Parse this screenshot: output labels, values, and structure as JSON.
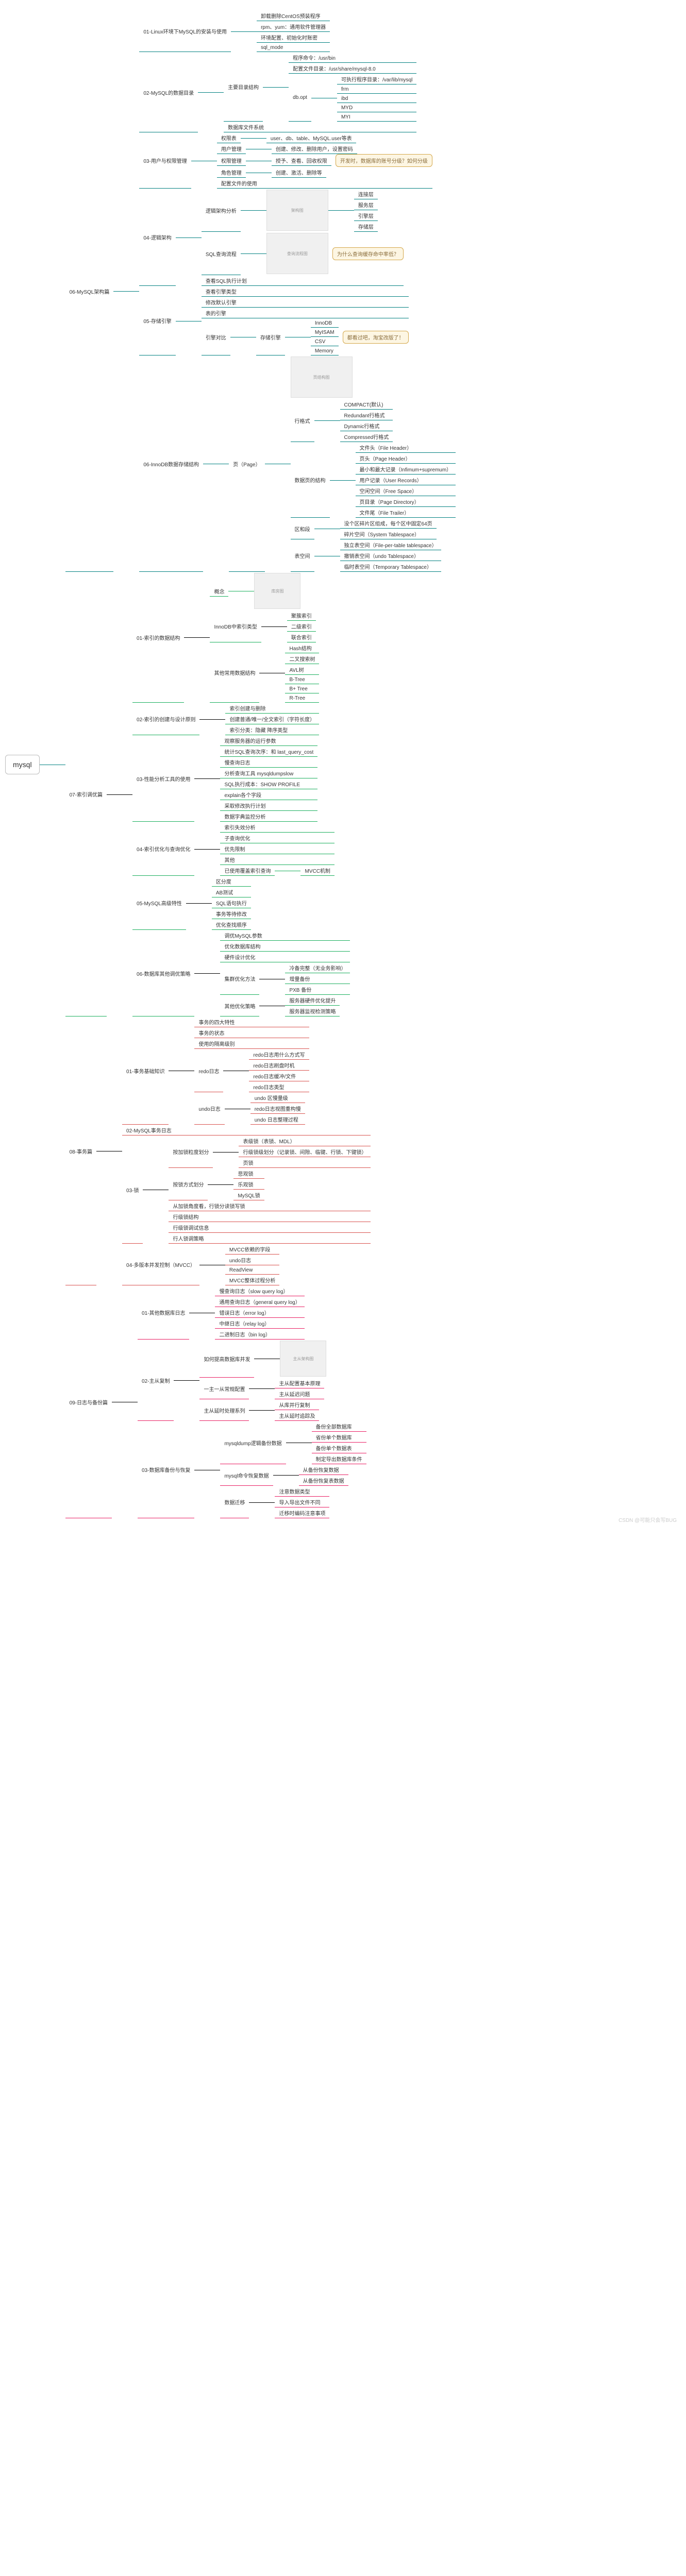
{
  "root": "mysql",
  "watermark": "CSDN @可能只会写BUG",
  "sections": {
    "s06": {
      "title": "06-MySQL架构篇",
      "n01": {
        "title": "01-Linux环境下MySQL的安装与使用",
        "items": [
          "卸载删除CentOS预装程序",
          "rpm、yum：通用软件管理器",
          "环境配置、初始化时账密",
          "sql_mode"
        ]
      },
      "n02": {
        "title": "02-MySQL的数据目录",
        "dir": {
          "label": "主要目录结构",
          "items": [
            {
              "l": "程序命令：/usr/bin"
            },
            {
              "l": "配置文件目录：/usr/share/mysql-8.0"
            },
            {
              "l": "db.opt",
              "sub": [
                "可执行程序目录：/var/lib/mysql",
                "frm",
                "ibd",
                "MYD",
                "MYI"
              ]
            }
          ]
        },
        "file": {
          "label": "数据库文件系统"
        }
      },
      "n03": {
        "title": "03-用户与权限管理",
        "items": [
          {
            "l": "权限表",
            "r": "user、db、table、MySQL.user等表"
          },
          {
            "l": "用户管理",
            "r": "创建、修改、删除用户，设置密码"
          },
          {
            "l": "权限管理",
            "r": "授予、查看、回收权限",
            "cb": "开发时，数据库的账号分级？如何分级"
          },
          {
            "l": "角色管理",
            "r": "创建、激活、删除等"
          },
          {
            "l": "配置文件的使用",
            "r": ""
          }
        ]
      },
      "n04": {
        "title": "04-逻辑架构",
        "arch": {
          "label": "逻辑架构分析",
          "imgs": [
            "架构图"
          ],
          "right": [
            "连接层",
            "服务层",
            "引擎层",
            "存储层"
          ]
        },
        "sql": {
          "label": "SQL查询流程",
          "img": "查询流程图",
          "cb": "为什么查询缓存命中率低？"
        },
        "other": [
          "查看SQL执行计划"
        ]
      },
      "n05": {
        "title": "05-存储引擎",
        "items": [
          "查看引擎类型",
          "修改默认引擎",
          "表的引擎",
          "引擎对比"
        ],
        "engines": {
          "l": "存储引擎",
          "list": [
            "InnoDB",
            "MyISAM",
            "CSV",
            "Memory"
          ],
          "cb": "都看过吧，淘宝改版了！"
        }
      },
      "n06": {
        "title": "06-InnoDB数据存储结构",
        "block": {
          "l": "页（Page）",
          "img": "页结构图",
          "format": {
            "l": "行格式",
            "list": [
              "COMPACT(默认)",
              "Redundant行格式",
              "Dynamic行格式",
              "Compressed行格式"
            ]
          },
          "struct": {
            "l": "数据页的结构",
            "list": [
              "文件头（File Header）",
              "页头（Page Header）",
              "最小和最大记录（Infimum+supremum）",
              "用户记录（User Records）",
              "空闲空间（Free Space）",
              "页目录（Page Directory）",
              "文件尾（File Trailer）"
            ]
          },
          "area": {
            "l": "区和段",
            "sub": [
              "没个区碎片区组成，每个区中固定64页",
              "碎片空间（System Tablespace）"
            ]
          },
          "ts": {
            "l": "表空间",
            "list": [
              "独立表空间（File-per-table tablespace）",
              "撤销表空间（undo Tablespace）",
              "临时表空间（Temporary Tablespace）"
            ]
          }
        }
      }
    },
    "s07": {
      "title": "07-索引调优篇",
      "n01": {
        "title": "01-索引的数据结构",
        "img": "库房图",
        "innodb": {
          "l": "InnoDB中索引类型",
          "list": [
            "聚簇索引",
            "二级索引",
            "联合索引"
          ]
        },
        "other": {
          "l": "其他常用数据结构",
          "list": [
            "Hash结构",
            "二叉搜索树",
            "AVL树",
            "B-Tree",
            "B+ Tree",
            "R-Tree"
          ]
        }
      },
      "n02": {
        "title": "02-索引的创建与设计原则",
        "items": [
          "索引创建与删除",
          "创建普通/唯一/全文索引（字符长度）",
          "索引分类：隐藏 降序类型"
        ]
      },
      "n03": {
        "title": "03-性能分析工具的使用",
        "items": [
          "观察服务器的运行参数",
          "统计SQL查询次序：和 last_query_cost",
          "慢查询日志",
          "分析查询工具 mysqldumpslow",
          "SQL执行成本：SHOW PROFILE",
          "explain各个字段",
          "采取修改执行计划",
          "数据字典监控分析"
        ]
      },
      "n04": {
        "title": "04-索引优化与查询优化",
        "items": [
          "索引失效分析",
          "子查询优化",
          "优先限制",
          "其他",
          {
            "l": "已使用覆盖索引查询",
            "r": "MVCC机制"
          }
        ]
      },
      "n05": {
        "title": "05-MySQL高级特性",
        "items": [
          "区分度",
          "AB测试",
          "SQL语句执行",
          "事务等待修改",
          "优化查找顺序"
        ]
      },
      "n06": {
        "title": "06-数据库其他调优策略",
        "items": [
          "调优MySQL参数",
          "优化数据库结构",
          "硬件设计优化",
          {
            "l": "集群优化方法",
            "sub": [
              "冷备完整（无业务影响）",
              "增量备份",
              "PXB 备份"
            ]
          },
          {
            "l": "其他优化策略",
            "sub": [
              "服务器硬件优化提升",
              "服务器监视检测策略"
            ]
          }
        ]
      }
    },
    "s08": {
      "title": "08-事务篇",
      "n01": {
        "title": "01-事务基础知识",
        "items": [
          "事务的四大特性",
          "事务的状态",
          "使用的隔离级别",
          {
            "l": "redo日志",
            "sub": [
              "redo日志用什么方式写",
              "redo日志刷盘时机",
              "redo日志缓冲/文件",
              "redo日志类型"
            ]
          },
          {
            "l": "undo日志",
            "sub": [
              "undo 区慢量级",
              "redo日志视图重构慢",
              "undo 日志整理过程"
            ]
          }
        ]
      },
      "n02": "02-MySQL事务日志",
      "n03": {
        "title": "03-锁",
        "items": [
          {
            "l": "按加锁粒度划分",
            "sub": [
              "表级锁（表锁、MDL）",
              "行级锁级划分（记录锁、间隙、临键、行锁、下键锁）",
              "页锁"
            ]
          },
          {
            "l": "按锁方式划分",
            "r": [
              "悲观锁",
              "乐观锁",
              "MySQL锁"
            ]
          },
          "从加锁角度看，行锁分读锁写锁",
          "行级锁结构",
          "行级锁调试信息",
          "行人锁调策略"
        ]
      },
      "n04": {
        "title": "04-多版本并发控制（MVCC）",
        "items": [
          "MVCC依赖的字段",
          "undo日志",
          "ReadView",
          "MVCC整体过程分析"
        ]
      }
    },
    "s09": {
      "title": "09-日志与备份篇",
      "n01": {
        "title": "01-其他数据库日志",
        "items": [
          "慢查询日志（slow query log）",
          "通用查询日志（general query log）",
          "错误日志（error log）",
          "中继日志（relay log）",
          "二进制日志（bin log）"
        ]
      },
      "n02": {
        "title": "02-主从复制",
        "items": [
          {
            "l": "如何提高数据库并发",
            "img": "主从架构图"
          },
          {
            "l": "一主一从常规配置",
            "sub": [
              "主从配置基本原理",
              "主从延迟问题"
            ]
          },
          {
            "l": "主从延时处理系列",
            "sub": [
              "从库并行复制",
              "主从延时追踪及"
            ]
          }
        ]
      },
      "n03": {
        "title": "03-数据库备份与恢复",
        "items": [
          {
            "l": "mysqldump逻辑备份数据",
            "sub": [
              "备份全部数据库",
              "省份单个数据库",
              "备份单个数据表",
              "制定导出数据库条件"
            ]
          },
          {
            "l": "mysql命令恢复数据",
            "sub": [
              "从备份恢复数据",
              "从备份恢复表数据"
            ]
          },
          {
            "l": "数据迁移",
            "sub": [
              "注意数据类型",
              "导入导出文件不同",
              "迁移时编码注意事项"
            ]
          }
        ]
      }
    }
  }
}
